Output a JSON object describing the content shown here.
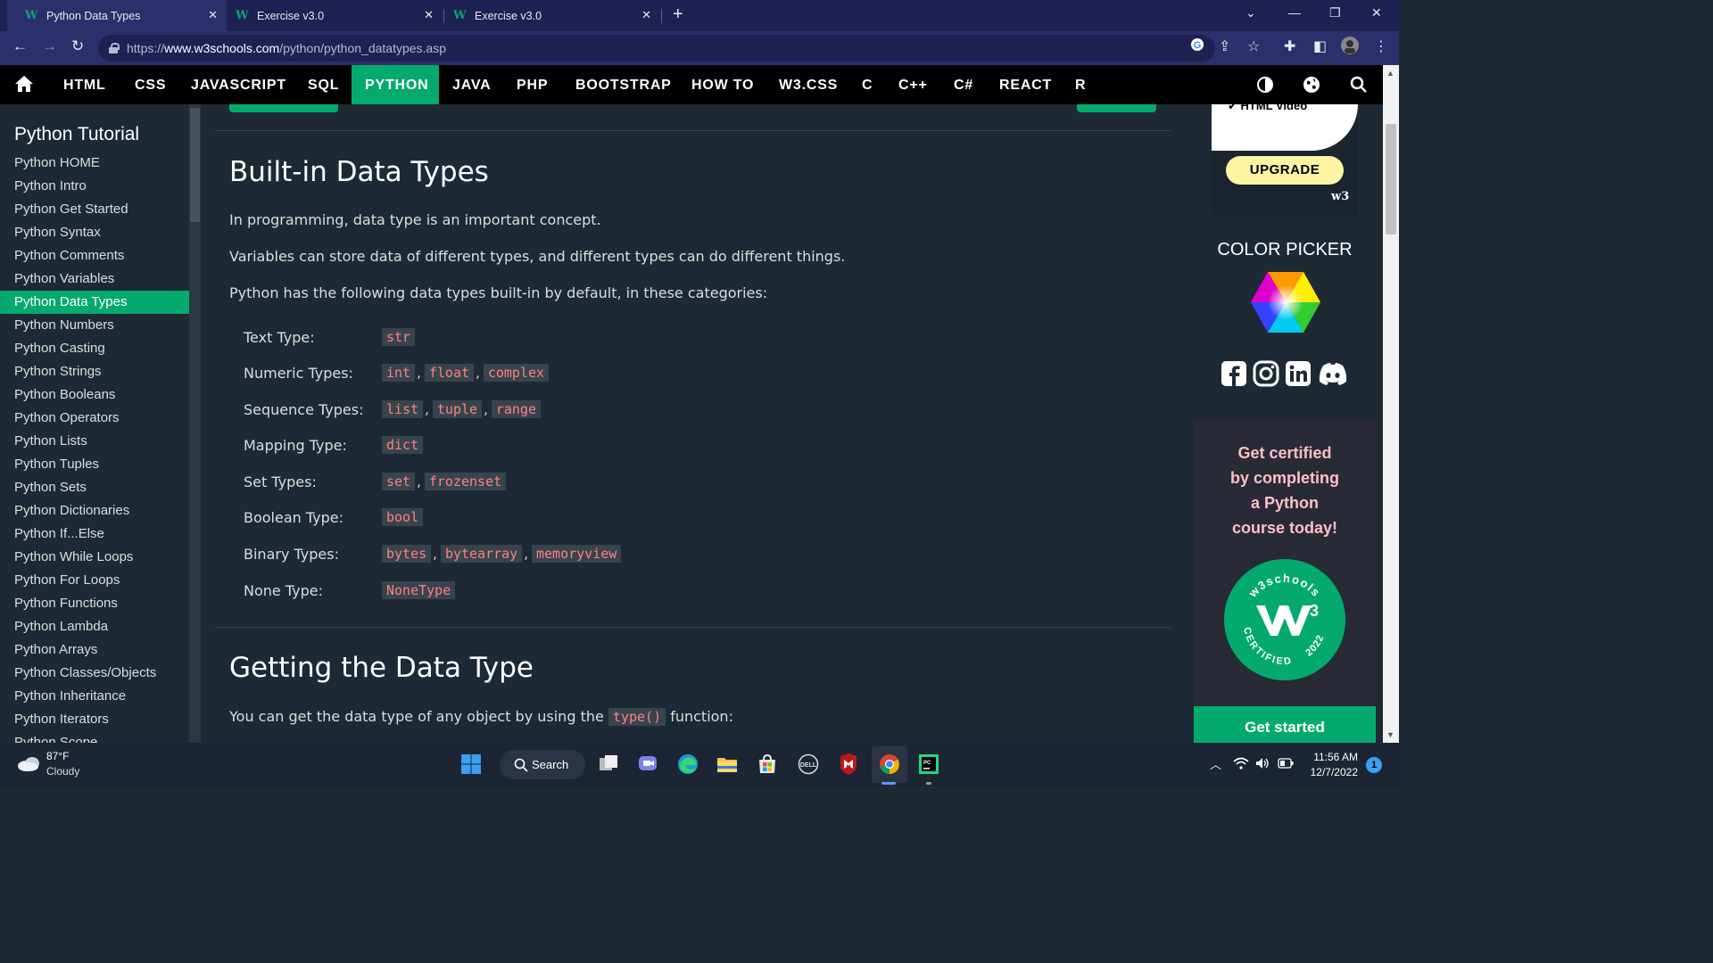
{
  "browser": {
    "tabs": [
      {
        "title": "Python Data Types",
        "active": true
      },
      {
        "title": "Exercise v3.0",
        "active": false
      },
      {
        "title": "Exercise v3.0",
        "active": false
      }
    ],
    "url_prefix": "https://",
    "url_domain": "www.w3schools.com",
    "url_path": "/python/python_datatypes.asp"
  },
  "topnav": {
    "items": [
      "HTML",
      "CSS",
      "JAVASCRIPT",
      "SQL",
      "PYTHON",
      "JAVA",
      "PHP",
      "BOOTSTRAP",
      "HOW TO",
      "W3.CSS",
      "C",
      "C++",
      "C#",
      "REACT",
      "R"
    ],
    "active": "PYTHON"
  },
  "sidebar": {
    "title": "Python Tutorial",
    "items": [
      "Python HOME",
      "Python Intro",
      "Python Get Started",
      "Python Syntax",
      "Python Comments",
      "Python Variables",
      "Python Data Types",
      "Python Numbers",
      "Python Casting",
      "Python Strings",
      "Python Booleans",
      "Python Operators",
      "Python Lists",
      "Python Tuples",
      "Python Sets",
      "Python Dictionaries",
      "Python If...Else",
      "Python While Loops",
      "Python For Loops",
      "Python Functions",
      "Python Lambda",
      "Python Arrays",
      "Python Classes/Objects",
      "Python Inheritance",
      "Python Iterators",
      "Python Scope"
    ],
    "active": "Python Data Types"
  },
  "main": {
    "heading1": "Built-in Data Types",
    "para1": "In programming, data type is an important concept.",
    "para2": "Variables can store data of different types, and different types can do different things.",
    "para3": "Python has the following data types built-in by default, in these categories:",
    "types": [
      {
        "label": "Text Type:",
        "values": [
          "str"
        ]
      },
      {
        "label": "Numeric Types:",
        "values": [
          "int",
          "float",
          "complex"
        ]
      },
      {
        "label": "Sequence Types:",
        "values": [
          "list",
          "tuple",
          "range"
        ]
      },
      {
        "label": "Mapping Type:",
        "values": [
          "dict"
        ]
      },
      {
        "label": "Set Types:",
        "values": [
          "set",
          "frozenset"
        ]
      },
      {
        "label": "Boolean Type:",
        "values": [
          "bool"
        ]
      },
      {
        "label": "Binary Types:",
        "values": [
          "bytes",
          "bytearray",
          "memoryview"
        ]
      },
      {
        "label": "None Type:",
        "values": [
          "NoneType"
        ]
      }
    ],
    "heading2": "Getting the Data Type",
    "para4_before": "You can get the data type of any object by using the",
    "para4_code": "type()",
    "para4_after": "function:"
  },
  "right": {
    "promo_caption": "HTML Video",
    "upgrade_label": "UPGRADE",
    "promo_logo": "w3",
    "color_picker_title": "COLOR PICKER",
    "social_icons": [
      "facebook-icon",
      "instagram-icon",
      "linkedin-icon",
      "discord-icon"
    ],
    "cert_text": [
      "Get certified",
      "by completing",
      "a Python",
      "course today!"
    ],
    "badge_top": "w3schools",
    "badge_bottom": "CERTIFIED",
    "badge_year": "2022",
    "get_started_label": "Get started"
  },
  "taskbar": {
    "temperature": "87°F",
    "weather": "Cloudy",
    "search_label": "Search",
    "time": "11:56 AM",
    "date": "12/7/2022",
    "notification_count": "1"
  },
  "colors": {
    "accent": "#04aa6d",
    "code_text": "#ff8080",
    "code_bg": "#38444d",
    "page_bg": "#1d2a35",
    "tab_bg": "#1e2152"
  }
}
